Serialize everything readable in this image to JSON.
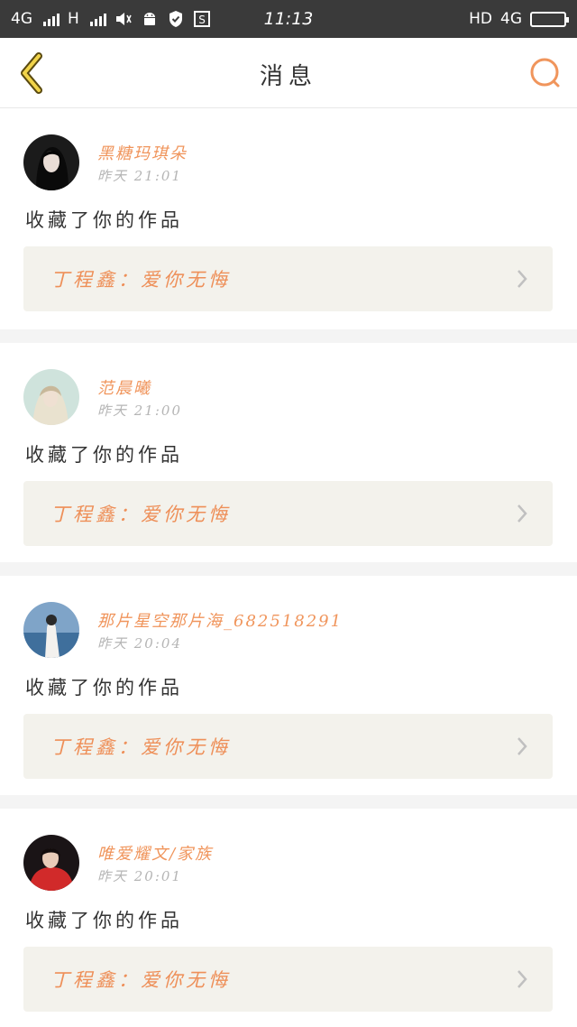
{
  "status_bar": {
    "network_left": "4G",
    "network_mid": "H",
    "time": "11:13",
    "hd": "HD",
    "network_right": "4G"
  },
  "header": {
    "title": "消息",
    "back_icon": "chevron-left-icon",
    "search_icon": "search-icon"
  },
  "messages": [
    {
      "username": "黑糖玛琪朵",
      "time": "昨天 21:01",
      "action": "收藏了你的作品",
      "work": "丁程鑫：爱你无悔"
    },
    {
      "username": "范晨曦",
      "time": "昨天 21:00",
      "action": "收藏了你的作品",
      "work": "丁程鑫：爱你无悔"
    },
    {
      "username": "那片星空那片海_682518291",
      "time": "昨天 20:04",
      "action": "收藏了你的作品",
      "work": "丁程鑫：爱你无悔"
    },
    {
      "username": "唯爱耀文/家族",
      "time": "昨天 20:01",
      "action": "收藏了你的作品",
      "work": "丁程鑫：爱你无悔"
    }
  ],
  "colors": {
    "accent": "#f0955c",
    "status_bar": "#3a3a3a",
    "card_link_bg": "#f3f2ec"
  }
}
